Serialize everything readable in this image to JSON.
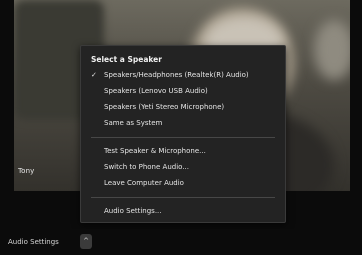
{
  "video": {
    "participant_name": "Tony"
  },
  "menu": {
    "heading": "Select a Speaker",
    "speakers": [
      {
        "label": "Speakers/Headphones (Realtek(R) Audio)",
        "selected": true
      },
      {
        "label": "Speakers (Lenovo USB Audio)",
        "selected": false
      },
      {
        "label": "Speakers (Yeti Stereo Microphone)",
        "selected": false
      },
      {
        "label": "Same as System",
        "selected": false
      }
    ],
    "actions": [
      {
        "label": "Test Speaker & Microphone..."
      },
      {
        "label": "Switch to Phone Audio..."
      },
      {
        "label": "Leave Computer Audio"
      }
    ],
    "settings": {
      "label": "Audio Settings..."
    },
    "check_glyph": "✓"
  },
  "toolbar": {
    "audio_settings_label": "Audio Settings",
    "chevron_glyph": "^"
  },
  "colors": {
    "menu_background": "#232323",
    "menu_text": "#e6e6e6",
    "app_background": "#0b0b0b"
  }
}
